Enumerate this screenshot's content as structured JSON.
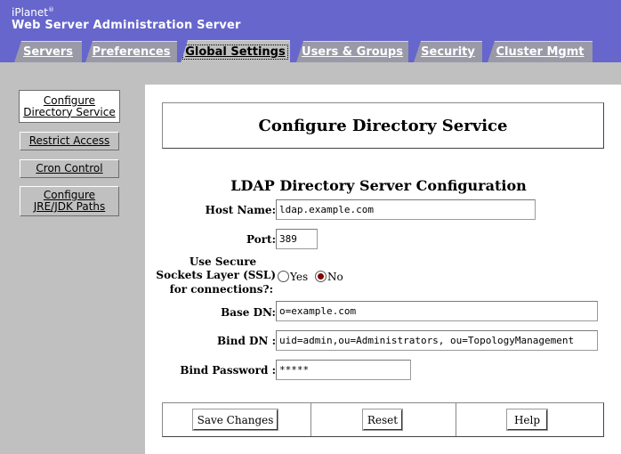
{
  "header": {
    "brand_small": "iPlanet",
    "brand_tm": "®",
    "title": "Web Server Administration Server"
  },
  "tabs": [
    {
      "label": "Servers",
      "active": false
    },
    {
      "label": "Preferences",
      "active": false
    },
    {
      "label": "Global Settings",
      "active": true
    },
    {
      "label": "Users & Groups",
      "active": false
    },
    {
      "label": "Security",
      "active": false
    },
    {
      "label": "Cluster Mgmt",
      "active": false
    }
  ],
  "sidebar": {
    "items": [
      {
        "line1": "Configure",
        "line2": "Directory Service",
        "active": true
      },
      {
        "line1": "Restrict Access",
        "line2": "",
        "active": false
      },
      {
        "line1": "Cron Control",
        "line2": "",
        "active": false
      },
      {
        "line1": "Configure",
        "line2": "JRE/JDK Paths",
        "active": false
      }
    ]
  },
  "main": {
    "page_title": "Configure Directory Service",
    "section_title": "LDAP Directory Server Configuration",
    "form": {
      "host_label": "Host Name:",
      "host_value": "ldap.example.com",
      "port_label": "Port:",
      "port_value": "389",
      "ssl_label_1": "Use Secure",
      "ssl_label_2": "Sockets Layer (SSL)",
      "ssl_label_3": "for connections?:",
      "ssl_yes": "Yes",
      "ssl_no": "No",
      "ssl_selected": "No",
      "base_dn_label": "Base DN:",
      "base_dn_value": "o=example.com",
      "bind_dn_label": "Bind DN :",
      "bind_dn_value": "uid=admin,ou=Administrators, ou=TopologyManagement",
      "bind_pw_label": "Bind Password :",
      "bind_pw_value": "*****"
    },
    "buttons": {
      "save": "Save Changes",
      "reset": "Reset",
      "help": "Help"
    }
  },
  "colors": {
    "header_bg": "#6666cc",
    "tab_bg": "#9999a8",
    "panel_bg": "#c0c0c0",
    "radio_selected": "#800000"
  }
}
